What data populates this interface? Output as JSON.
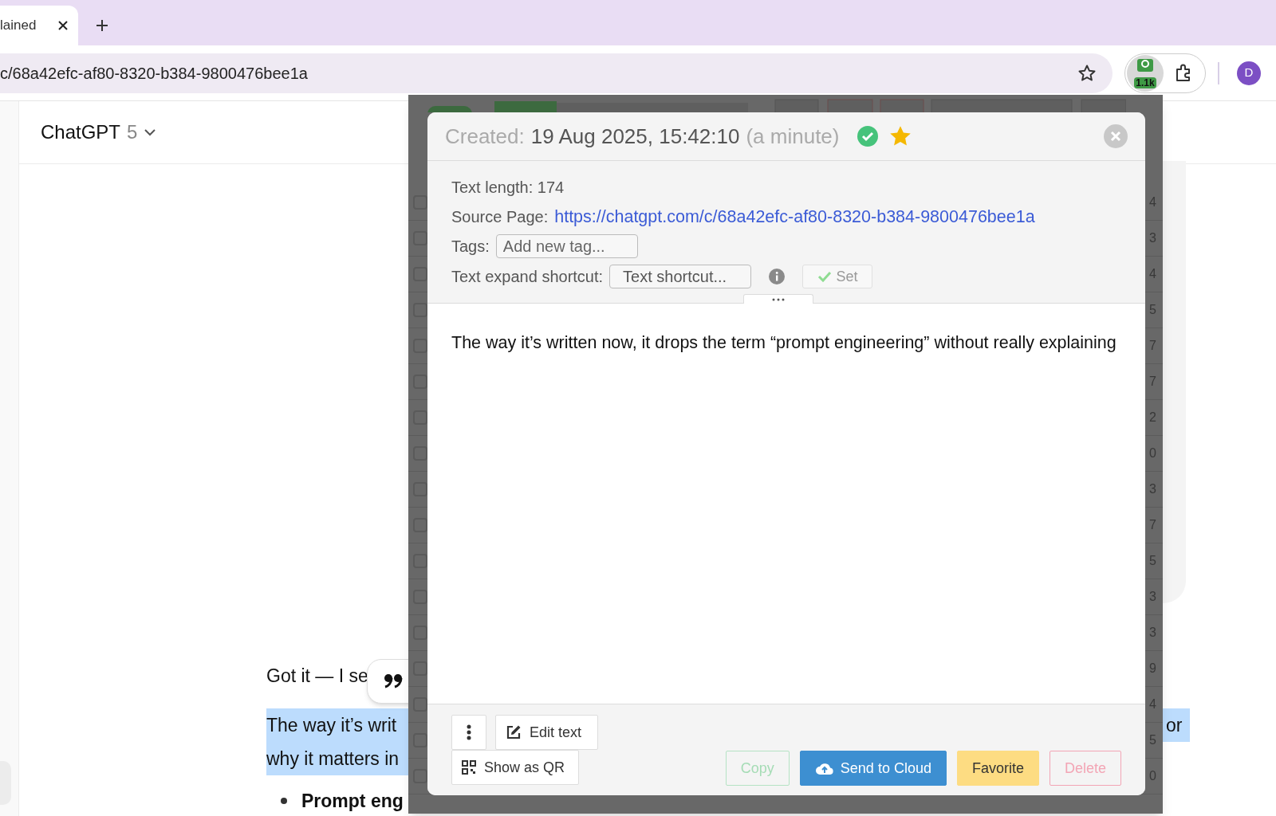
{
  "browser": {
    "tab": {
      "title": "lained",
      "selected": true
    },
    "address": "c/68a42efc-af80-8320-b384-9800476bee1a",
    "extension_badge": "1.1k",
    "profile_initial": "D"
  },
  "chat": {
    "model_name": "ChatGPT",
    "model_version": "5",
    "lines": [
      {
        "kind": "plain",
        "text": "Got it — I se",
        "selected": false
      },
      {
        "kind": "plain",
        "text": "The way it’s writ",
        "selected": true
      },
      {
        "kind": "plain",
        "text": "why it matters in",
        "selected": true
      },
      {
        "kind": "bullet",
        "text": "Prompt eng",
        "selected": false
      }
    ],
    "right_fragment": {
      "text": "or",
      "selected": true
    }
  },
  "background_list": {
    "rows": [
      {
        "value": "4",
        "checked": false
      },
      {
        "value": "3",
        "checked": false
      },
      {
        "value": "4",
        "checked": false
      },
      {
        "value": "5",
        "checked": false
      },
      {
        "value": "7",
        "checked": false
      },
      {
        "value": "7",
        "checked": false
      },
      {
        "value": "2",
        "checked": false
      },
      {
        "value": "0",
        "checked": false
      },
      {
        "value": "3",
        "checked": false
      },
      {
        "value": "7",
        "checked": false
      },
      {
        "value": "5",
        "checked": false
      },
      {
        "value": "3",
        "checked": false
      },
      {
        "value": "3",
        "checked": false
      },
      {
        "value": "9",
        "checked": false
      },
      {
        "value": "4",
        "checked": false
      },
      {
        "value": "5",
        "checked": false
      },
      {
        "value": "0",
        "checked": false
      }
    ]
  },
  "popup": {
    "created_label": "Created:",
    "created_value": "19 Aug 2025, 15:42:10",
    "created_relative": "(a minute)",
    "synced": true,
    "favorite": true,
    "text_length": "Text length: 174",
    "source_label": "Source Page:",
    "source_url": "https://chatgpt.com/c/68a42efc-af80-8320-b384-9800476bee1a",
    "tags_label": "Tags:",
    "tags_placeholder": "Add new tag...",
    "shortcut_label": "Text expand shortcut:",
    "shortcut_placeholder": "Text shortcut...",
    "set_button": {
      "label": "Set",
      "disabled": true
    },
    "content": "The way it’s written now, it drops the term “prompt engineering” without really explaining",
    "tool_buttons": [
      {
        "kind": "menu"
      },
      {
        "kind": "edit",
        "label": "Edit text"
      },
      {
        "kind": "qr",
        "label": "Show as QR"
      }
    ],
    "actions": [
      {
        "kind": "copy",
        "label": "Copy",
        "disabled": true
      },
      {
        "kind": "cloud",
        "label": "Send to Cloud",
        "disabled": false
      },
      {
        "kind": "favorite",
        "label": "Favorite",
        "disabled": false
      },
      {
        "kind": "delete",
        "label": "Delete",
        "disabled": true
      }
    ]
  }
}
